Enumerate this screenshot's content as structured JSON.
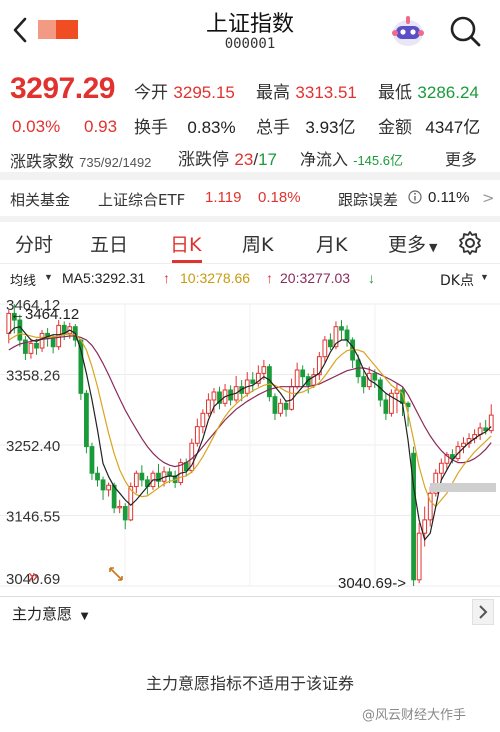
{
  "header": {
    "title": "上证指数",
    "code": "000001"
  },
  "quote": {
    "price": "3297.29",
    "change_pct": "0.03%",
    "change_abs": "0.93",
    "open_label": "今开",
    "open": "3295.15",
    "high_label": "最高",
    "high": "3313.51",
    "low_label": "最低",
    "low": "3286.24",
    "turnover_label": "换手",
    "turnover": "0.83%",
    "volume_label": "总手",
    "volume": "3.93亿",
    "amount_label": "金额",
    "amount": "4347亿",
    "adv_label": "涨跌家数",
    "adv": "735/92/1492",
    "limit_label": "涨跌停",
    "limit_up": "23",
    "limit_sep": "/",
    "limit_down": "17",
    "netflow_label": "净流入",
    "netflow": "-145.6亿",
    "more": "更多"
  },
  "fund": {
    "label": "相关基金",
    "name": "上证综合ETF",
    "price": "1.119",
    "pct": "0.18%",
    "tracking_label": "跟踪误差",
    "tracking": "0.11%",
    "arrow": ">"
  },
  "tabs": [
    {
      "label": "分时"
    },
    {
      "label": "五日"
    },
    {
      "label": "日K"
    },
    {
      "label": "周K"
    },
    {
      "label": "月K"
    },
    {
      "label": "更多"
    }
  ],
  "ma": {
    "label": "均线",
    "ma5": "MA5:3292.31",
    "ma10": "10:3278.66",
    "ma20": "20:3277.03",
    "dk": "DK点"
  },
  "chart_data": {
    "type": "candlestick",
    "y_ticks": [
      "3464.12",
      "3358.26",
      "3252.40",
      "3146.55",
      "3040.69"
    ],
    "ylim": [
      3040.69,
      3464.12
    ],
    "max_label": "←3464.12",
    "min_label": "3040.69->",
    "colors": {
      "up": "#e0332f",
      "down": "#1a9b3a",
      "ma5": "#222222",
      "ma10": "#d9a520",
      "ma20": "#8b2a5a"
    },
    "candles": [
      [
        3420,
        3450,
        3405,
        3455
      ],
      [
        3450,
        3440,
        3420,
        3464
      ],
      [
        3440,
        3410,
        3400,
        3448
      ],
      [
        3410,
        3390,
        3380,
        3416
      ],
      [
        3390,
        3405,
        3382,
        3412
      ],
      [
        3405,
        3398,
        3388,
        3412
      ],
      [
        3398,
        3420,
        3392,
        3425
      ],
      [
        3420,
        3412,
        3400,
        3428
      ],
      [
        3412,
        3400,
        3390,
        3418
      ],
      [
        3400,
        3432,
        3395,
        3440
      ],
      [
        3432,
        3420,
        3410,
        3438
      ],
      [
        3420,
        3430,
        3412,
        3436
      ],
      [
        3430,
        3410,
        3400,
        3434
      ],
      [
        3410,
        3330,
        3320,
        3412
      ],
      [
        3330,
        3250,
        3240,
        3335
      ],
      [
        3250,
        3210,
        3200,
        3256
      ],
      [
        3210,
        3200,
        3190,
        3220
      ],
      [
        3200,
        3185,
        3170,
        3205
      ],
      [
        3185,
        3192,
        3175,
        3196
      ],
      [
        3192,
        3158,
        3150,
        3196
      ],
      [
        3158,
        3160,
        3150,
        3170
      ],
      [
        3160,
        3140,
        3126,
        3165
      ],
      [
        3140,
        3190,
        3138,
        3196
      ],
      [
        3190,
        3210,
        3180,
        3214
      ],
      [
        3210,
        3200,
        3190,
        3222
      ],
      [
        3200,
        3190,
        3178,
        3206
      ],
      [
        3190,
        3210,
        3185,
        3214
      ],
      [
        3210,
        3198,
        3188,
        3224
      ],
      [
        3198,
        3212,
        3190,
        3220
      ],
      [
        3212,
        3206,
        3195,
        3218
      ],
      [
        3206,
        3196,
        3188,
        3214
      ],
      [
        3196,
        3226,
        3192,
        3232
      ],
      [
        3226,
        3214,
        3205,
        3232
      ],
      [
        3214,
        3255,
        3210,
        3262
      ],
      [
        3255,
        3280,
        3250,
        3292
      ],
      [
        3280,
        3300,
        3270,
        3306
      ],
      [
        3300,
        3320,
        3295,
        3330
      ],
      [
        3320,
        3332,
        3300,
        3338
      ],
      [
        3332,
        3315,
        3306,
        3340
      ],
      [
        3315,
        3335,
        3310,
        3344
      ],
      [
        3335,
        3320,
        3312,
        3342
      ],
      [
        3320,
        3340,
        3316,
        3356
      ],
      [
        3340,
        3330,
        3318,
        3350
      ],
      [
        3330,
        3350,
        3325,
        3362
      ],
      [
        3350,
        3345,
        3332,
        3362
      ],
      [
        3345,
        3360,
        3340,
        3372
      ],
      [
        3360,
        3370,
        3350,
        3380
      ],
      [
        3370,
        3325,
        3318,
        3374
      ],
      [
        3325,
        3300,
        3290,
        3330
      ],
      [
        3300,
        3315,
        3295,
        3322
      ],
      [
        3315,
        3306,
        3295,
        3320
      ],
      [
        3306,
        3340,
        3304,
        3352
      ],
      [
        3340,
        3365,
        3336,
        3376
      ],
      [
        3365,
        3355,
        3340,
        3372
      ],
      [
        3355,
        3342,
        3330,
        3360
      ],
      [
        3342,
        3358,
        3338,
        3368
      ],
      [
        3358,
        3385,
        3350,
        3392
      ],
      [
        3385,
        3410,
        3376,
        3416
      ],
      [
        3410,
        3400,
        3395,
        3420
      ],
      [
        3400,
        3430,
        3396,
        3438
      ],
      [
        3430,
        3425,
        3410,
        3440
      ],
      [
        3425,
        3410,
        3400,
        3432
      ],
      [
        3410,
        3380,
        3368,
        3414
      ],
      [
        3380,
        3355,
        3345,
        3388
      ],
      [
        3355,
        3340,
        3330,
        3364
      ],
      [
        3340,
        3360,
        3335,
        3370
      ],
      [
        3360,
        3350,
        3338,
        3366
      ],
      [
        3350,
        3320,
        3310,
        3354
      ],
      [
        3320,
        3300,
        3290,
        3330
      ],
      [
        3300,
        3330,
        3295,
        3336
      ],
      [
        3330,
        3335,
        3300,
        3345
      ],
      [
        3335,
        3315,
        3296,
        3340
      ],
      [
        3315,
        3310,
        3280,
        3318
      ],
      [
        3240,
        3050,
        3040.69,
        3250
      ],
      [
        3050,
        3120,
        3045,
        3135
      ],
      [
        3120,
        3140,
        3100,
        3160
      ],
      [
        3140,
        3180,
        3130,
        3190
      ],
      [
        3180,
        3210,
        3175,
        3216
      ],
      [
        3210,
        3225,
        3200,
        3232
      ],
      [
        3225,
        3238,
        3215,
        3242
      ],
      [
        3238,
        3232,
        3225,
        3246
      ],
      [
        3232,
        3250,
        3228,
        3258
      ],
      [
        3250,
        3255,
        3240,
        3264
      ],
      [
        3255,
        3262,
        3248,
        3270
      ],
      [
        3262,
        3268,
        3255,
        3276
      ],
      [
        3268,
        3278,
        3260,
        3286
      ],
      [
        3278,
        3274,
        3268,
        3290
      ],
      [
        3274,
        3297.29,
        3270,
        3313.51
      ]
    ],
    "ma5": [
      3420,
      3428,
      3430,
      3420,
      3410,
      3408,
      3412,
      3415,
      3418,
      3418,
      3420,
      3425,
      3420,
      3395,
      3360,
      3320,
      3275,
      3225,
      3205,
      3190,
      3180,
      3170,
      3162,
      3170,
      3180,
      3190,
      3200,
      3200,
      3204,
      3206,
      3205,
      3210,
      3212,
      3222,
      3240,
      3262,
      3290,
      3310,
      3318,
      3325,
      3328,
      3330,
      3336,
      3340,
      3342,
      3348,
      3355,
      3350,
      3340,
      3330,
      3318,
      3320,
      3330,
      3340,
      3350,
      3355,
      3360,
      3375,
      3392,
      3405,
      3410,
      3410,
      3400,
      3385,
      3365,
      3350,
      3345,
      3338,
      3330,
      3325,
      3320,
      3315,
      3260,
      3190,
      3140,
      3110,
      3120,
      3160,
      3200,
      3215,
      3230,
      3240,
      3248,
      3256,
      3262,
      3268,
      3272,
      3280
    ],
    "ma10": [
      3410,
      3415,
      3420,
      3418,
      3416,
      3414,
      3414,
      3414,
      3415,
      3416,
      3418,
      3419,
      3418,
      3410,
      3395,
      3370,
      3340,
      3305,
      3270,
      3240,
      3215,
      3198,
      3185,
      3178,
      3175,
      3176,
      3182,
      3188,
      3194,
      3198,
      3200,
      3204,
      3206,
      3212,
      3222,
      3235,
      3250,
      3266,
      3282,
      3295,
      3306,
      3314,
      3322,
      3328,
      3334,
      3338,
      3342,
      3344,
      3342,
      3338,
      3333,
      3330,
      3330,
      3332,
      3336,
      3340,
      3346,
      3356,
      3368,
      3380,
      3388,
      3394,
      3396,
      3395,
      3392,
      3382,
      3372,
      3362,
      3352,
      3342,
      3336,
      3330,
      3300,
      3260,
      3220,
      3190,
      3168,
      3160,
      3170,
      3180,
      3195,
      3210,
      3222,
      3232,
      3242,
      3250,
      3258,
      3266
    ],
    "ma20": [
      3395,
      3400,
      3404,
      3406,
      3408,
      3410,
      3411,
      3412,
      3413,
      3414,
      3415,
      3416,
      3416,
      3414,
      3410,
      3402,
      3390,
      3375,
      3358,
      3340,
      3322,
      3305,
      3290,
      3276,
      3262,
      3250,
      3240,
      3232,
      3226,
      3222,
      3220,
      3222,
      3226,
      3232,
      3240,
      3250,
      3260,
      3270,
      3280,
      3290,
      3298,
      3306,
      3312,
      3318,
      3323,
      3328,
      3332,
      3336,
      3338,
      3340,
      3340,
      3340,
      3340,
      3340,
      3340,
      3342,
      3344,
      3348,
      3352,
      3356,
      3360,
      3364,
      3366,
      3368,
      3368,
      3366,
      3362,
      3358,
      3354,
      3350,
      3345,
      3340,
      3328,
      3312,
      3296,
      3280,
      3266,
      3254,
      3244,
      3236,
      3230,
      3226,
      3226,
      3228,
      3232,
      3238,
      3246,
      3256
    ]
  },
  "indicator": {
    "label": "主力意愿",
    "note": "主力意愿指标不适用于该证券"
  },
  "watermark": "@风云财经大作手"
}
